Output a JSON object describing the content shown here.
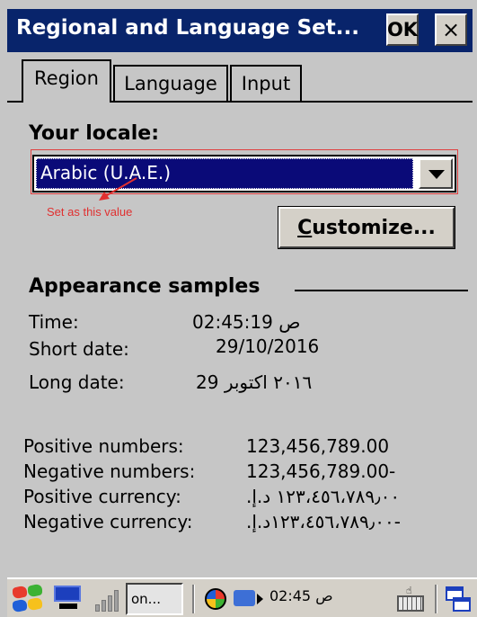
{
  "window": {
    "title": "Regional and Language Set...",
    "ok_label": "OK",
    "close_label": "×"
  },
  "tabs": [
    {
      "label": "Region",
      "active": true
    },
    {
      "label": "Language",
      "active": false
    },
    {
      "label": "Input",
      "active": false
    }
  ],
  "locale": {
    "label": "Your locale:",
    "selected_value": "Arabic (U.A.E.)",
    "annotation": "Set as this value",
    "customize_label": "Customize...",
    "customize_mnemonic": "C",
    "customize_rest": "ustomize..."
  },
  "appearance": {
    "heading": "Appearance samples",
    "rows": [
      {
        "label": "Time:",
        "value": "02:45:19 ص"
      },
      {
        "label": "Short date:",
        "value": "29/10/2016"
      },
      {
        "label": "Long date:",
        "value": "29 ٢٠١٦ اكتوبر"
      }
    ]
  },
  "numbers": {
    "rows": [
      {
        "label": "Positive numbers:",
        "value": "123,456,789.00"
      },
      {
        "label": "Negative numbers:",
        "value": "123,456,789.00-"
      },
      {
        "label": "Positive currency:",
        "value": "١٢٣،٤٥٦،٧٨٩٫٠٠ د.إ.‏"
      },
      {
        "label": "Negative currency:",
        "value": "١٢٣،٤٥٦،٧٨٩٫٠٠د.إ.‏-"
      }
    ]
  },
  "taskbar": {
    "task_label": "on...",
    "clock": "02:45 ص",
    "keyboard_glyph": "☝"
  },
  "colors": {
    "title_bar": "#08246b",
    "selection": "#0a0a78",
    "annotation": "#e03030",
    "background": "#c6c6c6"
  }
}
